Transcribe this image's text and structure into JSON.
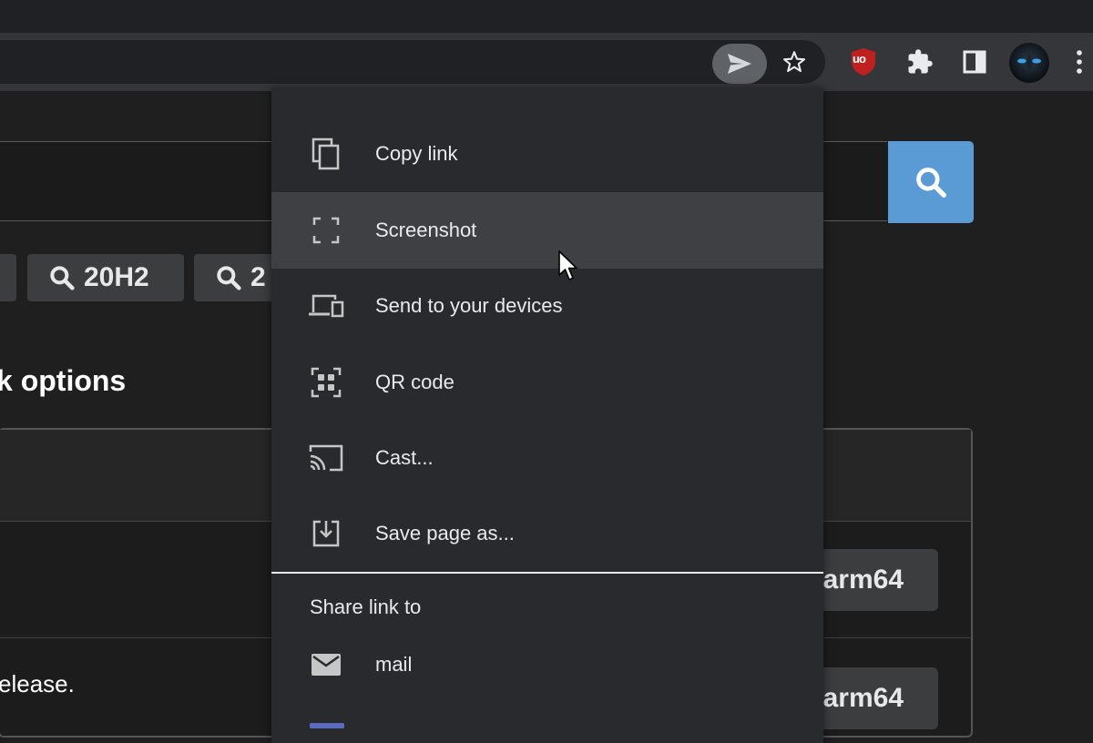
{
  "toolbar": {
    "share_icon": "send-icon",
    "bookmark_icon": "star-icon",
    "ublock_label": "uo",
    "extensions_icon": "puzzle-icon",
    "sidepanel_icon": "side-panel-icon",
    "menu_icon": "kebab-icon"
  },
  "page": {
    "search_icon": "search-icon",
    "chips": [
      {
        "label": ""
      },
      {
        "label": "20H2"
      },
      {
        "label": "2"
      }
    ],
    "section_heading": "k options",
    "rows": [
      {
        "text": "",
        "button": "arm64"
      },
      {
        "text": "elease.",
        "button": "arm64"
      }
    ]
  },
  "share_menu": {
    "items": [
      {
        "label": "Copy link",
        "icon": "copy-icon"
      },
      {
        "label": "Screenshot",
        "icon": "screenshot-icon"
      },
      {
        "label": "Send to your devices",
        "icon": "devices-icon"
      },
      {
        "label": "QR code",
        "icon": "qr-code-icon"
      },
      {
        "label": "Cast...",
        "icon": "cast-icon"
      },
      {
        "label": "Save page as...",
        "icon": "save-icon"
      }
    ],
    "hovered_index": 1,
    "share_link_heading": "Share link to",
    "share_targets": [
      {
        "label": "mail",
        "icon": "mail-icon"
      }
    ]
  },
  "colors": {
    "accent_search": "#5b9bd5",
    "ublock_red": "#c0201e",
    "menu_bg": "#292a2d",
    "menu_hover": "#3f4043"
  }
}
